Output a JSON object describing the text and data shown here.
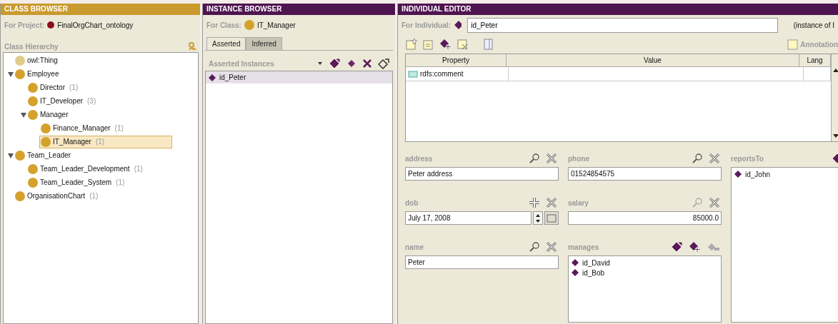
{
  "class_browser": {
    "title": "CLASS BROWSER",
    "project_label": "For Project:",
    "project": "FinalOrgChart_ontology",
    "hierarchy_label": "Class Hierarchy",
    "tree": [
      {
        "name": "owl:Thing",
        "color": "#e0cc8a",
        "selected": false
      },
      {
        "name": "Employee",
        "color": "#d4a22c",
        "selected": false,
        "expanded": true,
        "children": [
          {
            "name": "Director",
            "count": "(1)",
            "color": "#d4a22c",
            "selected": false
          },
          {
            "name": "IT_Developer",
            "count": "(3)",
            "color": "#d4a22c",
            "selected": false
          },
          {
            "name": "Manager",
            "color": "#d4a22c",
            "selected": false,
            "expanded": true,
            "children": [
              {
                "name": "Finance_Manager",
                "count": "(1)",
                "color": "#d4a22c",
                "selected": false
              },
              {
                "name": "IT_Manager",
                "count": "(1)",
                "color": "#d4a22c",
                "selected": true
              }
            ]
          }
        ]
      },
      {
        "name": "Team_Leader",
        "color": "#d4a22c",
        "selected": false,
        "expanded": true,
        "children": [
          {
            "name": "Team_Leader_Development",
            "count": "(1)",
            "color": "#d4a22c",
            "selected": false
          },
          {
            "name": "Team_Leader_System",
            "count": "(1)",
            "color": "#d4a22c",
            "selected": false
          }
        ]
      },
      {
        "name": "OrganisationChart",
        "count": "(1)",
        "color": "#d4a22c",
        "selected": false
      }
    ]
  },
  "instance_browser": {
    "title": "INSTANCE BROWSER",
    "class_label": "For Class:",
    "class": "IT_Manager",
    "tabs": [
      {
        "label": "Asserted",
        "selected": true
      },
      {
        "label": "Inferred",
        "selected": false
      }
    ],
    "list_label": "Asserted Instances",
    "instances": [
      {
        "name": "id_Peter",
        "selected": true
      }
    ]
  },
  "individual_editor": {
    "title": "INDIVIDUAL EDITOR",
    "individual_label": "For Individual:",
    "individual": "id_Peter",
    "instance_of": "(instance of I",
    "annotations_label": "Annotation",
    "table": {
      "columns": [
        "Property",
        "Value",
        "Lang"
      ],
      "rows": [
        {
          "property": "rdfs:comment"
        }
      ]
    },
    "widgets": [
      {
        "kind": "text",
        "label": "address",
        "value": "Peter address"
      },
      {
        "kind": "date",
        "label": "dob",
        "value": "July 17, 2008"
      },
      {
        "kind": "text",
        "label": "name",
        "value": "Peter"
      },
      {
        "kind": "text",
        "label": "phone",
        "value": "01524854575"
      },
      {
        "kind": "number",
        "label": "salary",
        "value": "85000.0"
      },
      {
        "kind": "list",
        "label": "manages",
        "items": [
          "id_David",
          "id_Bob"
        ]
      },
      {
        "kind": "list",
        "label": "reportsTo",
        "items": [
          "id_John"
        ]
      }
    ]
  }
}
